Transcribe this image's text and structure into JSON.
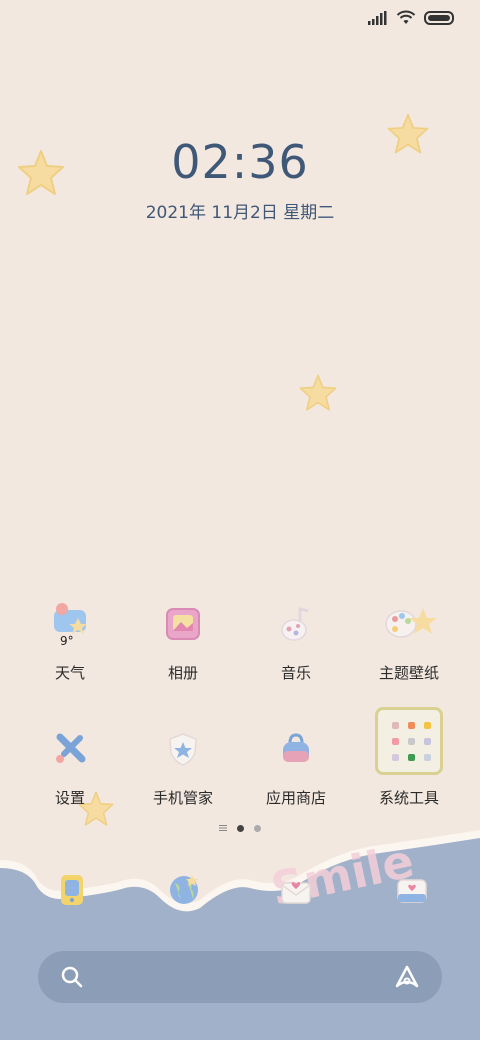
{
  "clock": {
    "time": "02:36",
    "date": "2021年 11月2日 星期二"
  },
  "apps": [
    {
      "label": "天气",
      "icon": "weather-icon",
      "temp": "9°"
    },
    {
      "label": "相册",
      "icon": "gallery-icon"
    },
    {
      "label": "音乐",
      "icon": "music-icon"
    },
    {
      "label": "主题壁纸",
      "icon": "theme-palette-icon"
    },
    {
      "label": "设置",
      "icon": "settings-icon"
    },
    {
      "label": "手机管家",
      "icon": "security-shield-icon"
    },
    {
      "label": "应用商店",
      "icon": "app-store-bag-icon"
    },
    {
      "label": "系统工具",
      "icon": "folder-icon"
    }
  ],
  "dock": [
    {
      "icon": "phone-icon"
    },
    {
      "icon": "browser-globe-icon"
    },
    {
      "icon": "messages-icon"
    },
    {
      "icon": "camera-icon"
    }
  ],
  "wallpaper_text": "Smile",
  "colors": {
    "background": "#f3e8df",
    "dock": "#a1b1c9",
    "clock": "#3f5878",
    "star": "#f6dca0"
  }
}
